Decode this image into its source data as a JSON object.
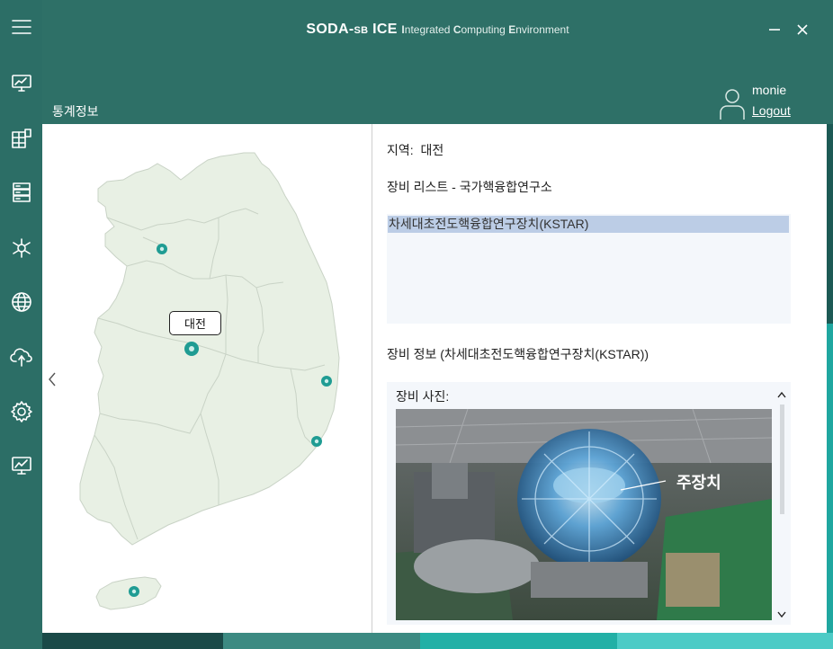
{
  "app": {
    "title_main": "SODA-",
    "title_sb": "SB",
    "title_ice": " ICE ",
    "title_sub_I": "I",
    "title_sub_1": "ntegrated ",
    "title_sub_C": "C",
    "title_sub_2": "omputing ",
    "title_sub_E": "E",
    "title_sub_3": "nvironment"
  },
  "header": {
    "page_title": "통계정보",
    "user_name": "monie",
    "logout_label": "Logout"
  },
  "rail": {
    "icons": [
      "menu-icon",
      "monitor-dashboard-icon",
      "building-icon",
      "server-icon",
      "bio-molecule-icon",
      "network-globe-icon",
      "cloud-upload-icon",
      "settings-gear-icon",
      "chart-monitor-icon"
    ]
  },
  "map": {
    "selected_region_label": "대전",
    "markers": [
      "seoul-marker",
      "daejeon-marker",
      "pohang-marker",
      "ulsan-marker",
      "jeju-marker"
    ],
    "land_color": "#e8f0e4",
    "marker_color": "#1f9c93"
  },
  "detail": {
    "region_label": "지역:",
    "region_value": "대전",
    "list_title": "장비 리스트  - 국가핵융합연구소",
    "list_items": [
      "차세대초전도핵융합연구장치(KSTAR)"
    ],
    "info_title": "장비 정보  (차세대초전도핵융합연구장치(KSTAR))",
    "photo_label": "장비 사진:",
    "photo_annotation": "주장치"
  },
  "bottom_bar_colors": [
    "#1a4a48",
    "#3c8a82",
    "#22b0a6",
    "#4ccbc6"
  ]
}
